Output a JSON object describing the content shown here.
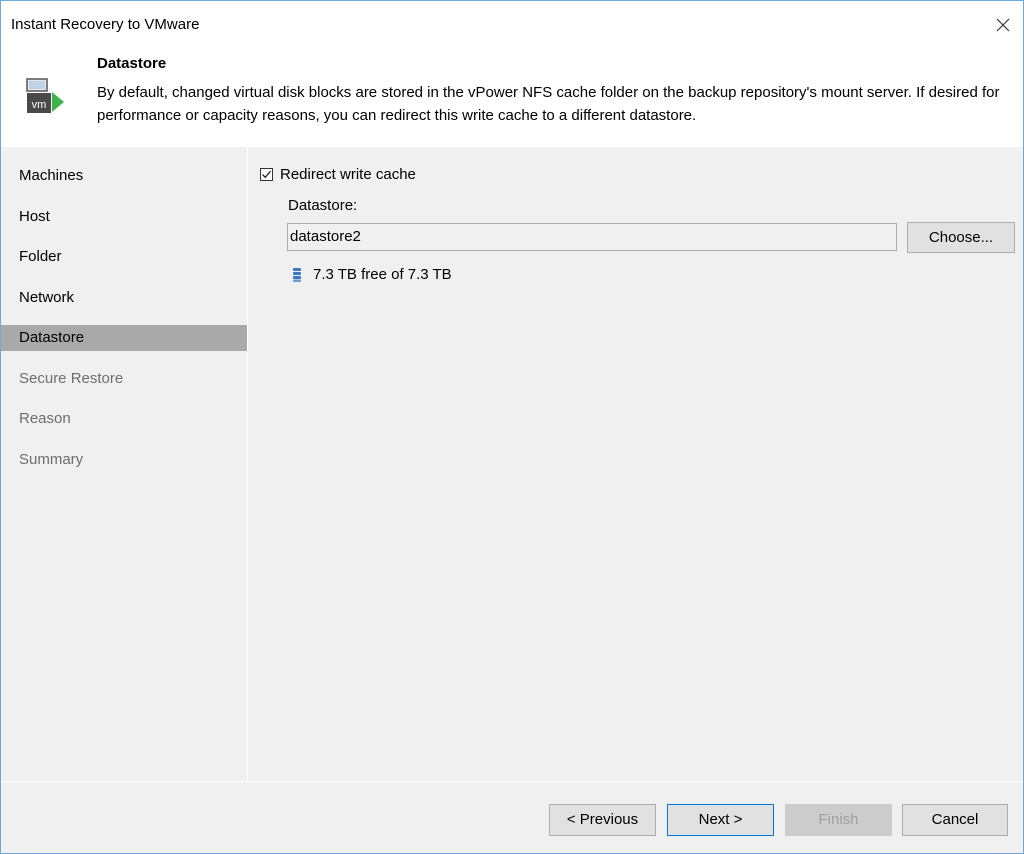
{
  "window": {
    "title": "Instant Recovery to VMware",
    "close_glyph": "✕"
  },
  "header": {
    "title": "Datastore",
    "description": "By default, changed virtual disk blocks are stored in the vPower NFS cache folder on the backup repository's mount server. If desired for performance or capacity reasons, you can redirect this write cache to a different datastore.",
    "icon": "vm-restore-icon",
    "icon_text": "vm"
  },
  "sidebar": {
    "items": [
      {
        "label": "Machines",
        "state": "done"
      },
      {
        "label": "Host",
        "state": "done"
      },
      {
        "label": "Folder",
        "state": "done"
      },
      {
        "label": "Network",
        "state": "done"
      },
      {
        "label": "Datastore",
        "state": "active"
      },
      {
        "label": "Secure Restore",
        "state": "pending"
      },
      {
        "label": "Reason",
        "state": "pending"
      },
      {
        "label": "Summary",
        "state": "pending"
      }
    ]
  },
  "content": {
    "redirect_checkbox": {
      "label": "Redirect write cache",
      "checked": true
    },
    "datastore_label": "Datastore:",
    "datastore_value": "datastore2",
    "choose_button": "Choose...",
    "free_space": "7.3 TB free of 7.3 TB",
    "free_space_icon": "database-icon"
  },
  "footer": {
    "previous": "< Previous",
    "next": "Next >",
    "finish": "Finish",
    "cancel": "Cancel"
  },
  "colors": {
    "active_nav": "#a9a9a9",
    "pending_nav_text": "#6d6d6d",
    "accent_blue": "#0078d7",
    "icon_green": "#3cb44b"
  }
}
